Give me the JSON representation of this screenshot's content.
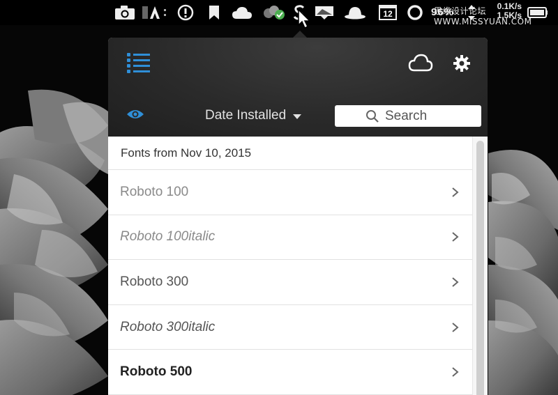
{
  "menubar": {
    "cpu_percent": "96%",
    "net_up": "0.1K/s",
    "net_down": "1.5K/s",
    "calendar_day": "12",
    "watermark": "思缘设计论坛 WWW.MISSYUAN.COM",
    "icons": [
      "camera-icon",
      "adobe-icon",
      "info-icon",
      "bookmark-icon",
      "cloud-icon",
      "sync-check-icon",
      "creative-cloud-s-icon",
      "screen-icon",
      "bowler-hat-icon",
      "calendar-icon",
      "progress-ring-icon",
      "network-icon",
      "battery-icon"
    ]
  },
  "panel": {
    "header": {
      "menu_icon": "list-icon",
      "cloud_icon": "cloud-icon",
      "settings_icon": "gear-icon",
      "visibility_icon": "eye-icon",
      "sort_label": "Date Installed",
      "search_placeholder": "Search"
    },
    "group_title": "Fonts from Nov 10, 2015",
    "fonts": [
      {
        "name": "Roboto 100",
        "style": "w100"
      },
      {
        "name": "Roboto 100italic",
        "style": "w100 ital"
      },
      {
        "name": "Roboto 300",
        "style": "w300"
      },
      {
        "name": "Roboto 300italic",
        "style": "w300 ital"
      },
      {
        "name": "Roboto 500",
        "style": "w500"
      }
    ]
  },
  "colors": {
    "accent": "#2f8fd8",
    "header_bg": "#2a2a2a",
    "menubar_bg": "#000000"
  }
}
